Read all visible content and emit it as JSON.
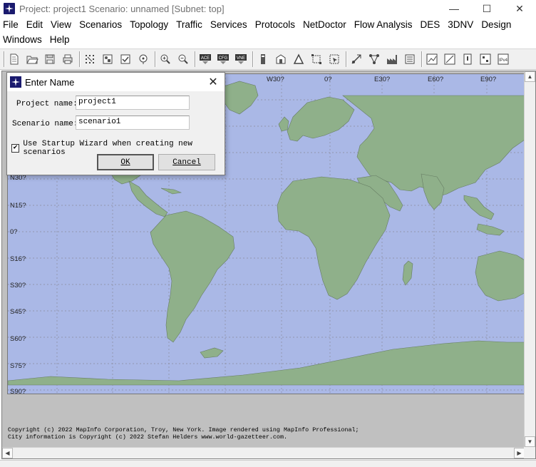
{
  "window": {
    "title": "Project: project1 Scenario: unnamed  [Subnet: top]",
    "minimize": "—",
    "maximize": "☐",
    "close": "✕"
  },
  "menu": {
    "row1": [
      "File",
      "Edit",
      "View",
      "Scenarios",
      "Topology",
      "Traffic",
      "Services",
      "Protocols",
      "NetDoctor",
      "Flow Analysis",
      "DES",
      "3DNV",
      "Design"
    ],
    "row2": [
      "Windows",
      "Help"
    ]
  },
  "toolbar": {
    "icons": [
      "new-project-icon",
      "open-icon",
      "save-icon",
      "print-icon",
      "grid-icon",
      "object-palette-icon",
      "check-links-icon",
      "fail-icon",
      "zoom-in-icon",
      "zoom-out-icon",
      "ace-icon",
      "cfg-icon",
      "vne-icon",
      "bookmark-icon",
      "device-icon",
      "triangle-icon",
      "expand-icon",
      "select-icon",
      "link-icon",
      "network-icon",
      "factory-icon",
      "results-icon",
      "graph-icon",
      "chart-icon",
      "report-icon",
      "compare-icon",
      "ipv4-icon"
    ],
    "labels": {
      "ace": "ACE",
      "cfg": "CFG",
      "vne": "VNE",
      "ipv": "IPv4"
    }
  },
  "map": {
    "longitudes": [
      "W30?",
      "0?",
      "E30?",
      "E60?",
      "E90?"
    ],
    "latitudes": [
      "N30?",
      "N15?",
      "0?",
      "S16?",
      "S30?",
      "S45?",
      "S60?",
      "S75?",
      "S90?"
    ],
    "ocean_color": "#aab8e6",
    "land_color": "#8fb08a",
    "copyright_line1": "Copyright (c) 2022 MapInfo Corporation, Troy, New York. Image rendered using MapInfo Professional;",
    "copyright_line2": "City information is Copyright (c) 2022 Stefan Helders www.world-gazetteer.com."
  },
  "dialog": {
    "title": "Enter Name",
    "project_label": "Project name:",
    "project_value": "project1",
    "scenario_label": "Scenario name:",
    "scenario_value": "scenario1",
    "wizard_label": "Use Startup Wizard when creating new scenarios",
    "wizard_checked": "✔",
    "ok_label": "OK",
    "cancel_label": "Cancel",
    "close": "✕"
  }
}
